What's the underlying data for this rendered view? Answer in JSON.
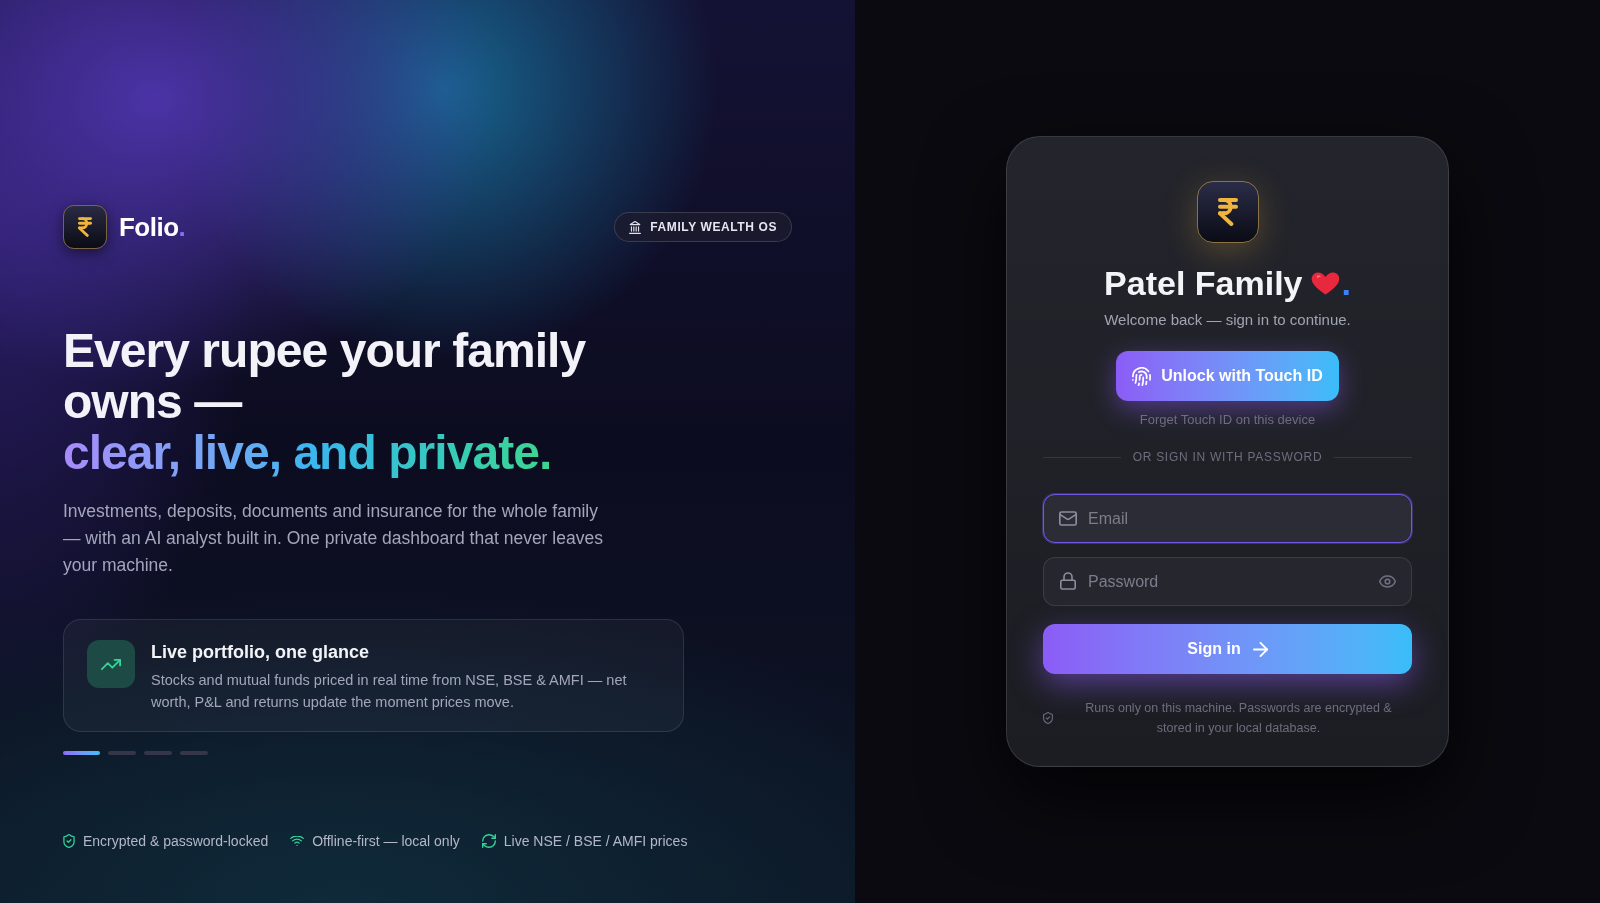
{
  "brand": {
    "name": "Folio",
    "accent": "."
  },
  "tagline": "FAMILY WEALTH OS",
  "hero": {
    "headline": "Every rupee your family owns —",
    "highlight": "clear, live, and private.",
    "description": "Investments, deposits, documents and insurance for the whole family — with an AI analyst built in. One private dashboard that never leaves your machine."
  },
  "feature": {
    "title": "Live portfolio, one glance",
    "description": "Stocks and mutual funds priced in real time from NSE, BSE & AMFI — net worth, P&L and returns update the moment prices move."
  },
  "carousel": {
    "dots": [
      {
        "selected": true
      },
      {
        "selected": false
      },
      {
        "selected": false
      },
      {
        "selected": false
      }
    ]
  },
  "trust_points": [
    "Encrypted & password-locked",
    "Offline-first — local only",
    "Live NSE / BSE / AMFI prices"
  ],
  "login": {
    "title": "Patel Family",
    "accent": ".",
    "subtitle": "Welcome back — sign in to continue.",
    "touch_id_button": "Unlock with Touch ID",
    "forget_link": "Forget Touch ID on this device",
    "divider": "OR SIGN IN WITH PASSWORD",
    "fields": [
      {
        "kind": "email",
        "placeholder": "Email",
        "focused": true
      },
      {
        "kind": "password",
        "placeholder": "Password",
        "focused": false
      }
    ],
    "submit": "Sign in",
    "footnote": "Runs only on this machine. Passwords are encrypted & stored in your local database."
  }
}
